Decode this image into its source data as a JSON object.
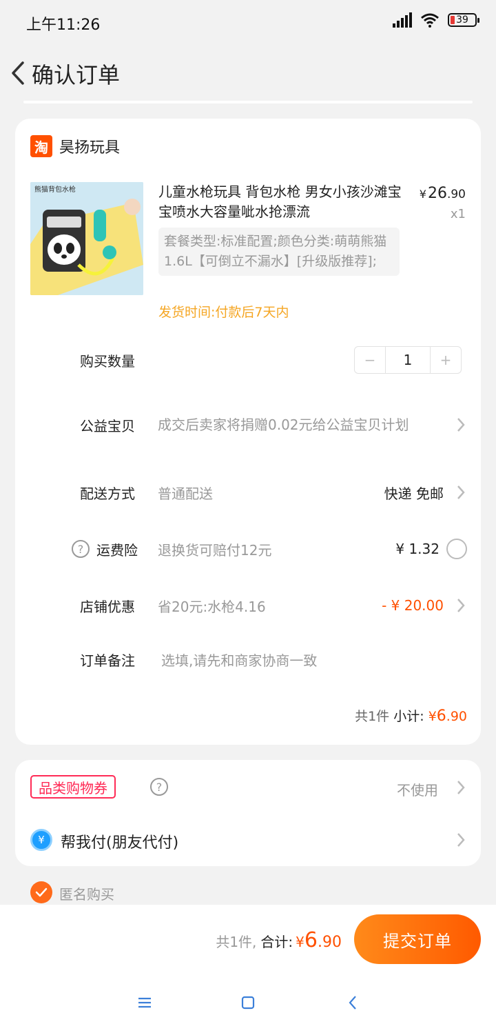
{
  "status_bar": {
    "time": "上午11:26",
    "battery": "39"
  },
  "nav": {
    "title": "确认订单"
  },
  "shop": {
    "logo_text": "淘",
    "name": "昊扬玩具"
  },
  "product": {
    "image_label": "熊猫背包水枪",
    "title": "儿童水枪玩具 背包水枪 男女小孩沙滩宝宝喷水大容量呲水抢漂流",
    "price_yen": "¥",
    "price_int": "26",
    "price_dec": ".90",
    "quantity": "x1",
    "sku": "套餐类型:标准配置;颜色分类:萌萌熊猫1.6L【可倒立不漏水】[升级版推荐];",
    "ship_time": "发货时间:付款后7天内"
  },
  "purchase_qty": {
    "label": "购买数量",
    "minus": "−",
    "value": "1",
    "plus": "+"
  },
  "charity": {
    "label": "公益宝贝",
    "value": "成交后卖家将捐赠0.02元给公益宝贝计划"
  },
  "delivery": {
    "label": "配送方式",
    "value": "普通配送",
    "right": "快递 免邮"
  },
  "insurance": {
    "help": "?",
    "label": "运费险",
    "value": "退换货可赔付12元",
    "right": "¥ 1.32"
  },
  "shop_discount": {
    "label": "店铺优惠",
    "value": "省20元:水枪4.16",
    "right": "- ¥ 20.00"
  },
  "remark": {
    "label": "订单备注",
    "placeholder": "选填,请先和商家协商一致"
  },
  "subtotal": {
    "count": "共1件",
    "label": "小计:",
    "yen": "¥",
    "int": "6",
    "dec": ".90"
  },
  "coupon": {
    "tag": "品类购物券",
    "help": "?",
    "value": "不使用"
  },
  "friend_pay": {
    "icon": "¥",
    "label": "帮我付(朋友代付)"
  },
  "anonymous": {
    "label": "匿名购买",
    "checked": true
  },
  "bottom": {
    "count": "共1件,",
    "label": "合计:",
    "yen": "¥",
    "int": "6",
    "dec": ".90",
    "submit": "提交订单"
  },
  "colors": {
    "accent": "#ff5000",
    "ship_time": "#f5a623",
    "coupon": "#ff2a55",
    "pay_blue": "#1e9fff"
  }
}
